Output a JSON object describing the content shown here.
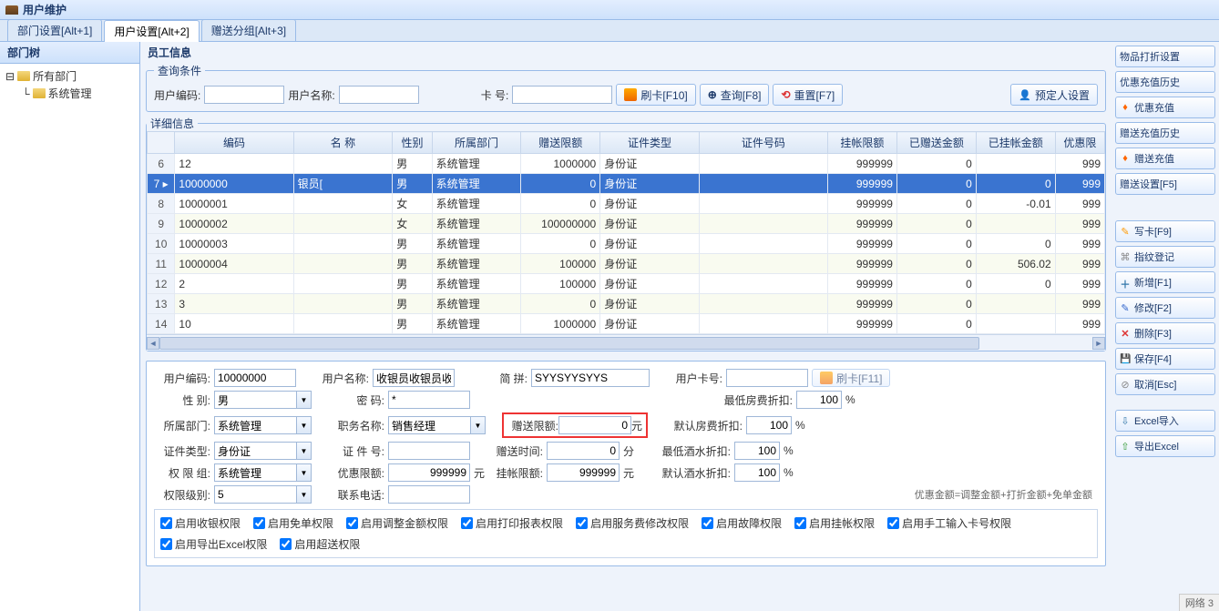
{
  "header": {
    "title": "用户维护"
  },
  "tabs": [
    {
      "label": "部门设置[Alt+1]"
    },
    {
      "label": "用户设置[Alt+2]"
    },
    {
      "label": "赠送分组[Alt+3]"
    }
  ],
  "left": {
    "title": "部门树",
    "root": "所有部门",
    "child": "系统管理"
  },
  "main_title": "员工信息",
  "query": {
    "legend": "查询条件",
    "user_code_label": "用户编码:",
    "user_name_label": "用户名称:",
    "card_label": "卡    号:",
    "brush_btn": "刷卡[F10]",
    "search_btn": "查询[F8]",
    "reset_btn": "重置[F7]",
    "preset_btn": "预定人设置"
  },
  "detail_legend": "详细信息",
  "columns": [
    "编码",
    "名  称",
    "性别",
    "所属部门",
    "赠送限额",
    "证件类型",
    "证件号码",
    "挂帐限额",
    "已赠送金额",
    "已挂帐金额",
    "优惠限"
  ],
  "rows": [
    {
      "n": 6,
      "code": "12",
      "name": "",
      "sex": "男",
      "dept": "系统管理",
      "gift": "1000000",
      "cert": "身份证",
      "certno": "",
      "credit": "999999",
      "gifted": "0",
      "credited": "",
      "disc": "999"
    },
    {
      "n": 7,
      "code": "10000000",
      "name": "      银员[",
      "sex": "男",
      "dept": "系统管理",
      "gift": "0",
      "cert": "身份证",
      "certno": "",
      "credit": "999999",
      "gifted": "0",
      "credited": "0",
      "disc": "999"
    },
    {
      "n": 8,
      "code": "10000001",
      "name": "",
      "sex": "女",
      "dept": "系统管理",
      "gift": "0",
      "cert": "身份证",
      "certno": "",
      "credit": "999999",
      "gifted": "0",
      "credited": "-0.01",
      "disc": "999"
    },
    {
      "n": 9,
      "code": "10000002",
      "name": "",
      "sex": "女",
      "dept": "系统管理",
      "gift": "100000000",
      "cert": "身份证",
      "certno": "",
      "credit": "999999",
      "gifted": "0",
      "credited": "",
      "disc": "999"
    },
    {
      "n": 10,
      "code": "10000003",
      "name": "",
      "sex": "男",
      "dept": "系统管理",
      "gift": "0",
      "cert": "身份证",
      "certno": "",
      "credit": "999999",
      "gifted": "0",
      "credited": "0",
      "disc": "999"
    },
    {
      "n": 11,
      "code": "10000004",
      "name": "",
      "sex": "男",
      "dept": "系统管理",
      "gift": "100000",
      "cert": "身份证",
      "certno": "",
      "credit": "999999",
      "gifted": "0",
      "credited": "506.02",
      "disc": "999"
    },
    {
      "n": 12,
      "code": "2",
      "name": "",
      "sex": "男",
      "dept": "系统管理",
      "gift": "100000",
      "cert": "身份证",
      "certno": "",
      "credit": "999999",
      "gifted": "0",
      "credited": "0",
      "disc": "999"
    },
    {
      "n": 13,
      "code": "3",
      "name": "",
      "sex": "男",
      "dept": "系统管理",
      "gift": "0",
      "cert": "身份证",
      "certno": "",
      "credit": "999999",
      "gifted": "0",
      "credited": "",
      "disc": "999"
    },
    {
      "n": 14,
      "code": "10",
      "name": "",
      "sex": "男",
      "dept": "系统管理",
      "gift": "1000000",
      "cert": "身份证",
      "certno": "",
      "credit": "999999",
      "gifted": "0",
      "credited": "",
      "disc": "999"
    }
  ],
  "selected_row": 1,
  "form": {
    "code_l": "用户编码:",
    "code_v": "10000000",
    "name_l": "用户名称:",
    "name_v": "收银员收银员收",
    "pin_l": "简      拼:",
    "pin_v": "SYYSYYSYYS",
    "ucard_l": "用户卡号:",
    "ucard_v": "",
    "brush2": "刷卡[F11]",
    "sex_l": "性      别:",
    "sex_v": "男",
    "pwd_l": "密      码:",
    "pwd_v": "*",
    "minroom_l": "最低房费折扣:",
    "minroom_v": "100",
    "pct": "%",
    "dept_l": "所属部门:",
    "dept_v": "系统管理",
    "job_l": "职务名称:",
    "job_v": "销售经理",
    "gift_l": "赠送限额:",
    "gift_v": "0",
    "yuan": "元",
    "defroom_l": "默认房费折扣:",
    "defroom_v": "100",
    "cert_l": "证件类型:",
    "cert_v": "身份证",
    "certno_l": "证  件  号:",
    "certno_v": "",
    "gifttime_l": "赠送时间:",
    "gifttime_v": "0",
    "fen": "分",
    "minwine_l": "最低酒水折扣:",
    "minwine_v": "100",
    "pg_l": "权  限  组:",
    "pg_v": "系统管理",
    "disc_l": "优惠限额:",
    "disc_v": "999999",
    "credit_l": "挂帐限额:",
    "credit_v": "999999",
    "defwine_l": "默认酒水折扣:",
    "defwine_v": "100",
    "plv_l": "权限级别:",
    "plv_v": "5",
    "tel_l": "联系电话:",
    "tel_v": "",
    "note": "优惠金额=调整金额+打折金额+免单金额"
  },
  "cbs": {
    "c1": "启用收银权限",
    "c2": "启用免单权限",
    "c3": "启用调整金额权限",
    "c4": "启用打印报表权限",
    "c5": "启用服务费修改权限",
    "c6": "启用故障权限",
    "c7": "启用挂帐权限",
    "c8": "启用手工输入卡号权限",
    "c9": "启用导出Excel权限",
    "c10": "启用超送权限"
  },
  "rbtns": {
    "b1": "物品打折设置",
    "b2": "优惠充值历史",
    "b3": "优惠充值",
    "b4": "赠送充值历史",
    "b5": "赠送充值",
    "b6": "赠送设置[F5]",
    "b7": "写卡[F9]",
    "b8": "指纹登记",
    "b9": "新增[F1]",
    "b10": "修改[F2]",
    "b11": "删除[F3]",
    "b12": "保存[F4]",
    "b13": "取消[Esc]",
    "b14": "Excel导入",
    "b15": "导出Excel"
  },
  "status": "网络 3"
}
